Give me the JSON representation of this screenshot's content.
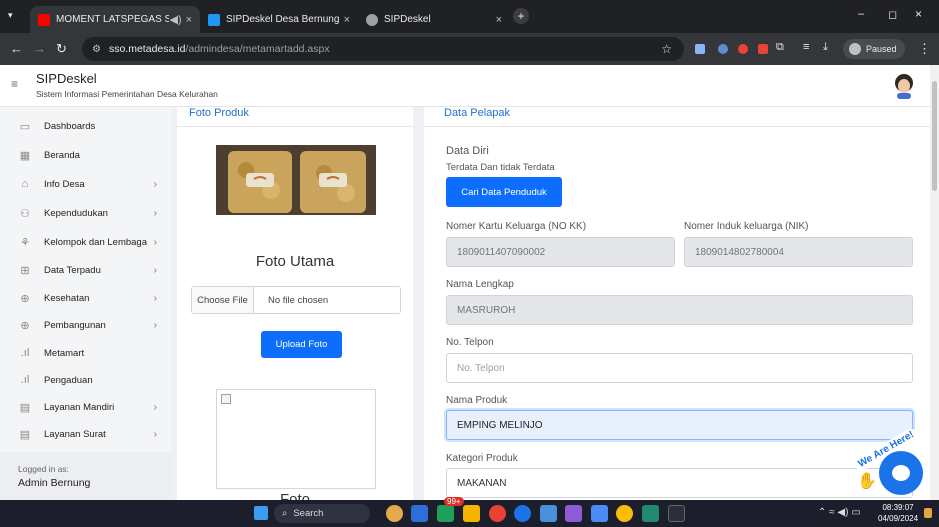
{
  "browser": {
    "tabs": [
      {
        "title": "MOMENT LATSPEGAS SYIL/",
        "icon": "youtube-icon",
        "color": "#ff0000"
      },
      {
        "title": "SIPDeskel Desa Bernung",
        "icon": "site-icon",
        "color": "#2196f3"
      },
      {
        "title": "SIPDeskel",
        "icon": "globe-icon",
        "color": "#9aa0a6"
      }
    ],
    "url_domain": "sso.metadesa.id",
    "url_path": "/admindesa/metamartadd.aspx",
    "paused_label": "Paused"
  },
  "app": {
    "title": "SIPDeskel",
    "subtitle": "Sistem Informasi Pemerintahan Desa Kelurahan"
  },
  "sidebar": {
    "items": [
      {
        "label": "Dashboards",
        "icon": "monitor-icon",
        "chevron": false
      },
      {
        "label": "Beranda",
        "icon": "grid-icon",
        "chevron": false
      },
      {
        "label": "Info Desa",
        "icon": "building-icon",
        "chevron": true
      },
      {
        "label": "Kependudukan",
        "icon": "users-icon",
        "chevron": true
      },
      {
        "label": "Kelompok dan Lembaga",
        "icon": "group-icon",
        "chevron": true
      },
      {
        "label": "Data Terpadu",
        "icon": "apps-icon",
        "chevron": true
      },
      {
        "label": "Kesehatan",
        "icon": "globe-icon",
        "chevron": true
      },
      {
        "label": "Pembangunan",
        "icon": "globe-icon",
        "chevron": true
      },
      {
        "label": "Metamart",
        "icon": "bar-chart-icon",
        "chevron": false
      },
      {
        "label": "Pengaduan",
        "icon": "bar-chart-icon",
        "chevron": false
      },
      {
        "label": "Layanan Mandiri",
        "icon": "window-icon",
        "chevron": true
      },
      {
        "label": "Layanan Surat",
        "icon": "window-icon",
        "chevron": true
      }
    ],
    "logged_in_label": "Logged in as:",
    "user_name": "Admin Bernung"
  },
  "foto": {
    "header": "Foto Produk",
    "caption": "Foto Utama",
    "choose_label": "Choose File",
    "no_file_label": "No file chosen",
    "upload_label": "Upload Foto",
    "caption2": "Foto"
  },
  "pelapak": {
    "header": "Data Pelapak",
    "section_title": "Data Diri",
    "section_sub": "Terdata Dan tidak Terdata",
    "search_button": "Cari Data Penduduk",
    "kk_label": "Nomer Kartu Keluarga (NO KK)",
    "kk_value": "1809011407090002",
    "nik_label": "Nomer Induk keluarga (NIK)",
    "nik_value": "1809014802780004",
    "nama_label": "Nama Lengkap",
    "nama_value": "MASRUROH",
    "telp_label": "No. Telpon",
    "telp_placeholder": "No. Telpon",
    "produk_label": "Nama Produk",
    "produk_value": "EMPING MELINJO",
    "kategori_label": "Kategori Produk",
    "kategori_value": "MAKANAN"
  },
  "chat": {
    "badge_text": "We Are Here!"
  },
  "taskbar": {
    "search_label": "Search",
    "time": "08:39:07",
    "date": "04/09/2024",
    "badge": "99+"
  }
}
